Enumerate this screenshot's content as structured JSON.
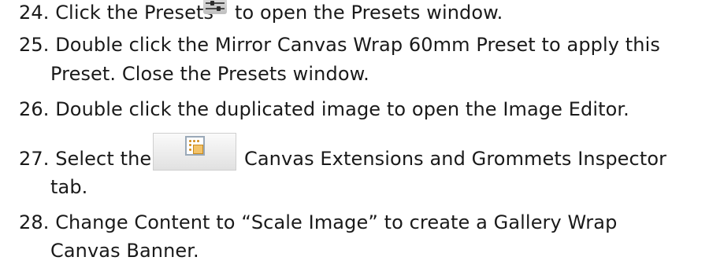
{
  "steps": [
    {
      "num": "24.",
      "parts": [
        "Click the Presets",
        "to open the Presets window."
      ]
    },
    {
      "num": "25.",
      "lines": [
        "Double click the Mirror Canvas Wrap 60mm Preset to apply this",
        "Preset. Close the Presets window."
      ]
    },
    {
      "num": "26.",
      "text": "Double click the duplicated image to open the Image Editor."
    },
    {
      "num": "27.",
      "parts": [
        "Select the",
        "Canvas Extensions and Grommets Inspector"
      ],
      "line2": "tab."
    },
    {
      "num": "28.",
      "lines": [
        "Change Content to “Scale Image” to create a Gallery Wrap",
        "Canvas Banner."
      ]
    }
  ],
  "icons": {
    "presets": "presets-sliders-icon",
    "canvas_extensions": "canvas-extensions-icon"
  }
}
